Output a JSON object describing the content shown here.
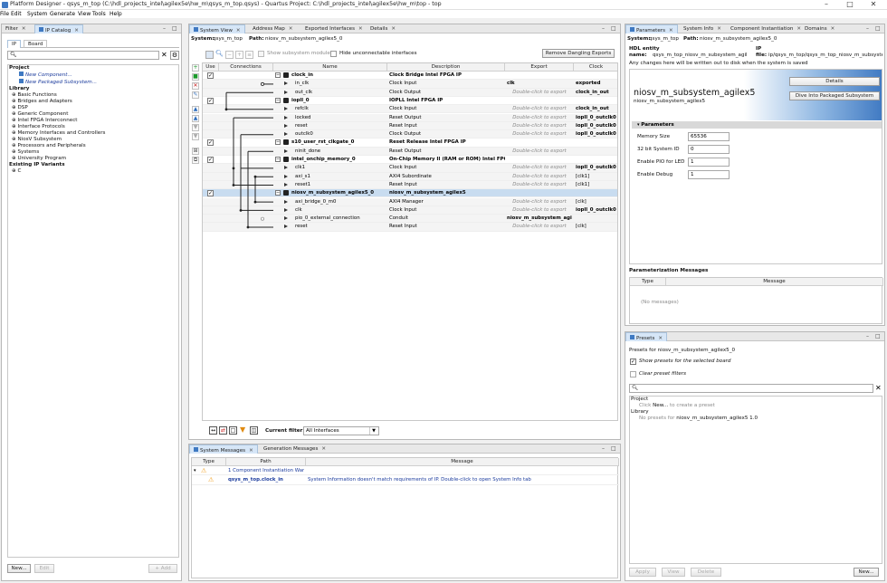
{
  "title": "Platform Designer - qsys_m_top (C:\\hdl_projects_intel\\agilex5e\\hw_m\\qsys_m_top.qsys) - Quartus Project: C:\\hdl_projects_intel\\agilex5e\\hw_m\\top - top",
  "menus": [
    "File",
    "Edit",
    "System",
    "Generate",
    "View",
    "Tools",
    "Help"
  ],
  "left": {
    "tab_filter": "Filter",
    "tab_catalog": "IP Catalog",
    "tab_ip": "IP",
    "tab_board": "Board",
    "search_placeholder": "",
    "project_label": "Project",
    "project_items": [
      "New Component...",
      "New Packaged Subsystem..."
    ],
    "library_label": "Library",
    "library_items": [
      "Basic Functions",
      "Bridges and Adapters",
      "DSP",
      "Generic Component",
      "Intel FPGA Interconnect",
      "Interface Protocols",
      "Memory Interfaces and Controllers",
      "NiosV Subsystem",
      "Processors and Peripherals",
      "Systems",
      "University Program"
    ],
    "existing_label": "Existing IP Variants",
    "existing_items": [
      "C"
    ],
    "btn_new": "New...",
    "btn_edit": "Edit",
    "btn_add": "+ Add"
  },
  "center": {
    "tabs": [
      "System View",
      "Address Map",
      "Exported Interfaces",
      "Details"
    ],
    "system_label": "System:",
    "system_value": "qsys_m_top",
    "path_label": "Path:",
    "path_value": "niosv_m_subsystem_agilex5_0",
    "show_subsystem": "Show subsystem modules",
    "hide_unconnectable": "Hide unconnectable interfaces",
    "remove_dangling": "Remove Dangling Exports",
    "columns": [
      "Use",
      "Connections",
      "Name",
      "Description",
      "Export",
      "Clock"
    ],
    "rows": [
      {
        "kind": "comp",
        "use": true,
        "name": "clock_in",
        "desc": "Clock Bridge Intel FPGA IP",
        "export": "",
        "clock": ""
      },
      {
        "kind": "port",
        "name": "in_clk",
        "desc": "Clock Input",
        "export": "clk",
        "clock": "exported"
      },
      {
        "kind": "port",
        "name": "out_clk",
        "desc": "Clock Output",
        "export": "Double-click to export",
        "clock": "clock_in_out"
      },
      {
        "kind": "comp",
        "use": true,
        "name": "iopll_0",
        "desc": "IOPLL Intel FPGA IP",
        "export": "",
        "clock": ""
      },
      {
        "kind": "port",
        "name": "refclk",
        "desc": "Clock Input",
        "export": "Double-click to export",
        "clock": "clock_in_out"
      },
      {
        "kind": "port",
        "name": "locked",
        "desc": "Reset Output",
        "export": "Double-click to export",
        "clock": "iopll_0_outclk0"
      },
      {
        "kind": "port",
        "name": "reset",
        "desc": "Reset Input",
        "export": "Double-click to export",
        "clock": "iopll_0_outclk0"
      },
      {
        "kind": "port",
        "name": "outclk0",
        "desc": "Clock Output",
        "export": "Double-click to export",
        "clock": "iopll_0_outclk0"
      },
      {
        "kind": "comp",
        "use": true,
        "name": "s10_user_rst_clkgate_0",
        "desc": "Reset Release Intel FPGA IP",
        "export": "",
        "clock": ""
      },
      {
        "kind": "port",
        "name": "ninit_done",
        "desc": "Reset Output",
        "export": "Double-click to export",
        "clock": ""
      },
      {
        "kind": "comp",
        "use": true,
        "name": "intel_onchip_memory_0",
        "desc": "On-Chip Memory II (RAM or ROM) Intel FPGA IP",
        "export": "",
        "clock": ""
      },
      {
        "kind": "port",
        "name": "clk1",
        "desc": "Clock Input",
        "export": "Double-click to export",
        "clock": "iopll_0_outclk0"
      },
      {
        "kind": "port",
        "name": "axi_s1",
        "desc": "AXI4 Subordinate",
        "export": "Double-click to export",
        "clock": "[clk1]"
      },
      {
        "kind": "port",
        "name": "reset1",
        "desc": "Reset Input",
        "export": "Double-click to export",
        "clock": "[clk1]"
      },
      {
        "kind": "comp",
        "use": true,
        "name": "niosv_m_subsystem_agilex5_0",
        "desc": "niosv_m_subsystem_agilex5",
        "export": "",
        "clock": "",
        "selected": true
      },
      {
        "kind": "port",
        "name": "axi_bridge_0_m0",
        "desc": "AXI4 Manager",
        "export": "Double-click to export",
        "clock": "[clk]"
      },
      {
        "kind": "port",
        "name": "clk",
        "desc": "Clock Input",
        "export": "Double-click to export",
        "clock": "iopll_0_outclk0"
      },
      {
        "kind": "port",
        "name": "pio_0_external_connection",
        "desc": "Conduit",
        "export": "niosv_m_subsystem_agil...",
        "clock": ""
      },
      {
        "kind": "port",
        "name": "reset",
        "desc": "Reset Input",
        "export": "Double-click to export",
        "clock": "[clk]"
      }
    ],
    "current_filter_label": "Current filter:",
    "current_filter_value": "All Interfaces"
  },
  "messages": {
    "tabs": [
      "System Messages",
      "Generation Messages"
    ],
    "columns": [
      "Type",
      "Path",
      "Message"
    ],
    "rows": [
      {
        "path": "1 Component Instantiation Warn...",
        "message": ""
      },
      {
        "path": "qsys_m_top.clock_in",
        "message": "System Information doesn't match requirements of IP. Double-click to open System Info tab"
      }
    ]
  },
  "right": {
    "tabs": [
      "Parameters",
      "System Info",
      "Component Instantiation",
      "Domains"
    ],
    "system_label": "System:",
    "system_value": "qsys_m_top",
    "path_label": "Path:",
    "path_value": "niosv_m_subsystem_agilex5_0",
    "hdl_label_1": "HDL entity",
    "hdl_label_2": "name:",
    "hdl_value": "qsys_m_top_niosv_m_subsystem_agil",
    "ip_label_1": "IP",
    "ip_label_2": "file:",
    "ip_value": "ip/qsys_m_top/qsys_m_top_niosv_m_subsystem...",
    "note": "Any changes here will be written out to disk when the system is saved",
    "comp_title": "niosv_m_subsystem_agilex5",
    "comp_sub": "niosv_m_subsystem_agilex5",
    "btn_details": "Details",
    "btn_dive": "Dive Into Packaged Subsystem",
    "params_header": "Parameters",
    "params": [
      {
        "label": "Memory Size",
        "value": "65536"
      },
      {
        "label": "32 bit System ID",
        "value": "0"
      },
      {
        "label": "Enable PIO for LED",
        "value": "1"
      },
      {
        "label": "Enable Debug",
        "value": "1"
      }
    ],
    "pmsg_header": "Parameterization Messages",
    "pmsg_cols": [
      "Type",
      "Message"
    ],
    "pmsg_empty": "(No messages)"
  },
  "presets": {
    "tab": "Presets",
    "for_label": "Presets for niosv_m_subsystem_agilex5_0",
    "show_board": "Show presets for the selected board",
    "clear_filter": "Clear preset filters",
    "project_label": "Project",
    "project_hint_pre": "Click",
    "project_hint_bold": "New...",
    "project_hint_post": "to create a preset",
    "library_label": "Library",
    "library_hint": "No presets for",
    "library_hint_bold": "niosv_m_subsystem_agilex5 1.0",
    "btn_apply": "Apply",
    "btn_view": "View",
    "btn_delete": "Delete",
    "btn_new": "New..."
  },
  "colors": {
    "accent": "#3f79c2",
    "selection": "#c8dcf0",
    "warning": "#f0a020",
    "link": "#1a3a9c"
  }
}
